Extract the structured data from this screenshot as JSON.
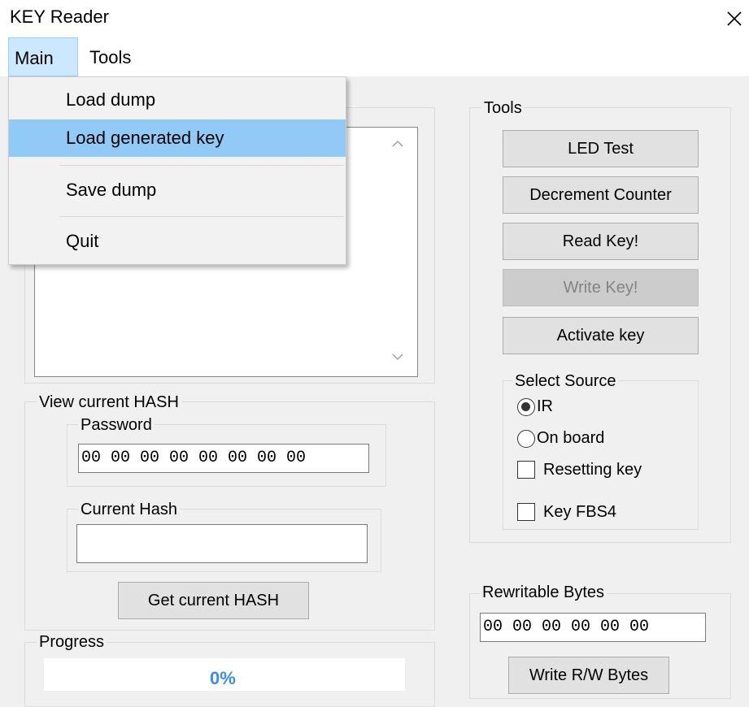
{
  "window": {
    "title": "KEY Reader"
  },
  "menubar": {
    "main": "Main",
    "tools": "Tools"
  },
  "main_menu": {
    "items": [
      "Load dump",
      "Load generated key",
      "Save dump",
      "Quit"
    ],
    "highlighted": "Load generated key"
  },
  "tools_group": {
    "label": "Tools",
    "buttons": {
      "led_test": "LED Test",
      "decrement_counter": "Decrement Counter",
      "read_key": "Read Key!",
      "write_key": "Write Key!",
      "activate_key": "Activate key"
    },
    "write_key_enabled": false
  },
  "select_source": {
    "label": "Select Source",
    "ir": "IR",
    "on_board": "On board",
    "selected": "IR",
    "resetting_key": "Resetting key",
    "resetting_key_checked": false,
    "key_fbs4": "Key FBS4",
    "key_fbs4_checked": false
  },
  "hash_group": {
    "label": "View current HASH",
    "password_label": "Password",
    "password_value": "00 00 00 00 00 00 00 00",
    "current_hash_label": "Current Hash",
    "current_hash_value": "",
    "get_hash_button": "Get current HASH"
  },
  "rewritable": {
    "label": "Rewritable Bytes",
    "value": "00 00 00 00 00 00",
    "write_button": "Write R/W Bytes"
  },
  "progress": {
    "label": "Progress",
    "text": "0%",
    "value": 0
  },
  "colors": {
    "menu_highlight": "#91c9f7",
    "progress_text": "#3c8de8"
  }
}
